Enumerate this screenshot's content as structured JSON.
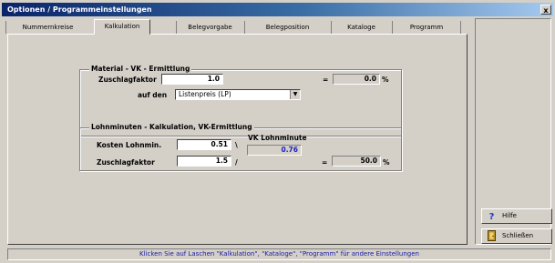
{
  "window": {
    "title": "Optionen / Programmeinstellungen",
    "close_glyph": "x"
  },
  "tabs": [
    {
      "label": "Nummernkreise"
    },
    {
      "label": "Kalkulation",
      "active": true
    },
    {
      "label": "Belegvorgabe"
    },
    {
      "label": "Belegposition"
    },
    {
      "label": "Kataloge"
    },
    {
      "label": "Programm"
    }
  ],
  "material_group": {
    "title": "Material - VK - Ermittlung",
    "zuschlag_label": "Zuschlagfaktor",
    "zuschlag_value": "1.0",
    "eq_sign": "=",
    "percent_value": "0.0",
    "percent_unit": "%",
    "basis_label": "auf den",
    "basis_value": "Listenpreis (LP)"
  },
  "lohn_group": {
    "title": "Lohnminuten - Kalkulation, VK-Ermittlung",
    "kosten_label": "Kosten Lohnmin.",
    "kosten_value": "0.51",
    "kosten_unit": "\\",
    "vk_lohnminute_label": "VK Lohnminute",
    "vk_lohnminute_value": "0.76",
    "zuschlag_label": "Zuschlagfaktor",
    "zuschlag_value": "1.5",
    "zuschlag_sep": "/",
    "eq_sign": "=",
    "percent_value": "50.0",
    "percent_unit": "%"
  },
  "buttons": {
    "help_label": "Hilfe",
    "help_icon": "question-icon",
    "close_label": "Schließen",
    "close_icon": "exit-door-icon"
  },
  "status": {
    "text": "Klicken Sie auf Laschen \"Kalkulation\", \"Kataloge\", \"Programm\" für andere Einstellungen"
  },
  "colors": {
    "titlebar_start": "#0a246a",
    "titlebar_end": "#a6caf0",
    "status_text": "#1a1aa6",
    "value_blue": "#2020c0"
  }
}
